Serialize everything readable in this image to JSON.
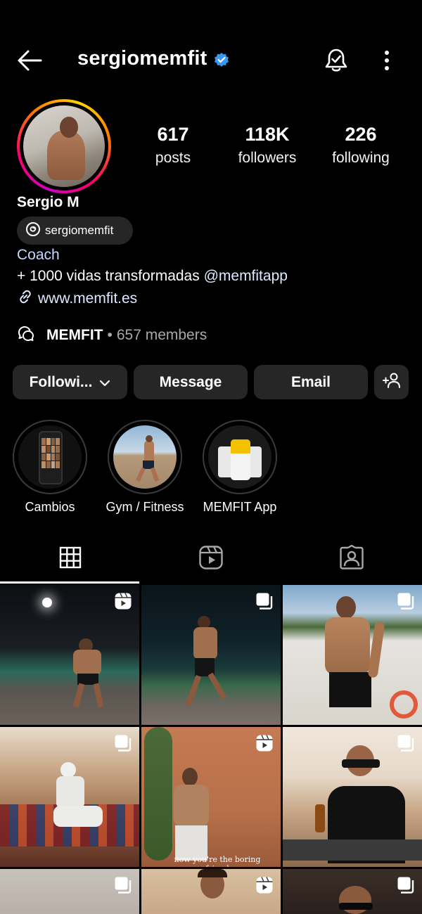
{
  "header": {
    "username": "sergiomemfit",
    "verified_color": "#3897f0"
  },
  "profile": {
    "full_name": "Sergio M",
    "threads_handle": "sergiomemfit",
    "bio_category": "Coach",
    "bio_text": "+ 1000 vidas transformadas ",
    "bio_mention": "@memfitapp",
    "bio_link": "www.memfit.es"
  },
  "stats": [
    {
      "value": "617",
      "label": "posts"
    },
    {
      "value": "118K",
      "label": "followers"
    },
    {
      "value": "226",
      "label": "following"
    }
  ],
  "channel": {
    "name": "MEMFIT",
    "separator": "•",
    "members": "657 members"
  },
  "buttons": {
    "following": "Followi...",
    "message": "Message",
    "email": "Email"
  },
  "highlights": [
    {
      "label": "Cambios"
    },
    {
      "label": "Gym / Fitness"
    },
    {
      "label": "MEMFIT App"
    }
  ],
  "tabs": [
    "grid-icon",
    "reels-icon",
    "tagged-icon"
  ],
  "grid_posts": [
    {
      "type": "reel"
    },
    {
      "type": "carousel"
    },
    {
      "type": "carousel"
    },
    {
      "type": "carousel"
    },
    {
      "type": "reel"
    },
    {
      "type": "carousel"
    },
    {
      "type": "carousel"
    },
    {
      "type": "reel"
    },
    {
      "type": "carousel"
    }
  ],
  "grid_caption": "now you're the boring friend"
}
